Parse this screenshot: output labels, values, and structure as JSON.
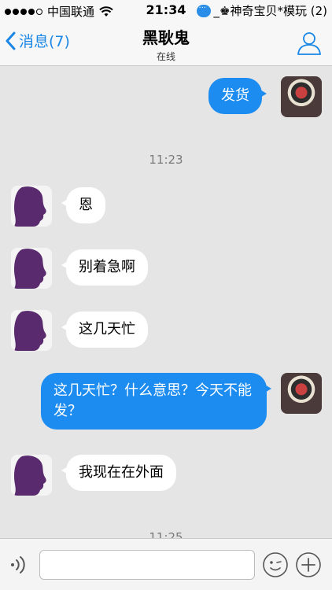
{
  "status_bar": {
    "carrier": "中国联通",
    "time": "21:34",
    "notification": "_♚神奇宝贝*模玩 (2)"
  },
  "nav": {
    "back_label": "消息(7)",
    "title": "黑耿鬼",
    "subtitle": "在线"
  },
  "messages": [
    {
      "from": "me",
      "text": "发货"
    },
    {
      "timestamp": "11:23"
    },
    {
      "from": "them",
      "text": "恩"
    },
    {
      "from": "them",
      "text": "别着急啊"
    },
    {
      "from": "them",
      "text": "这几天忙"
    },
    {
      "from": "me",
      "text": "这几天忙？什么意思？今天不能发？"
    },
    {
      "from": "them",
      "text": "我现在在外面"
    },
    {
      "timestamp": "11:25"
    }
  ],
  "input": {
    "placeholder": "",
    "value": ""
  },
  "icons": {
    "back": "chevron-left-icon",
    "profile": "user-icon",
    "voice": "voice-icon",
    "emoji": "emoji-icon",
    "plus": "plus-icon"
  },
  "colors": {
    "accent": "#1a87e6",
    "outgoing_bubble": "#1c8cf0",
    "incoming_bubble": "#ffffff",
    "chat_background": "#e5e5e5"
  }
}
